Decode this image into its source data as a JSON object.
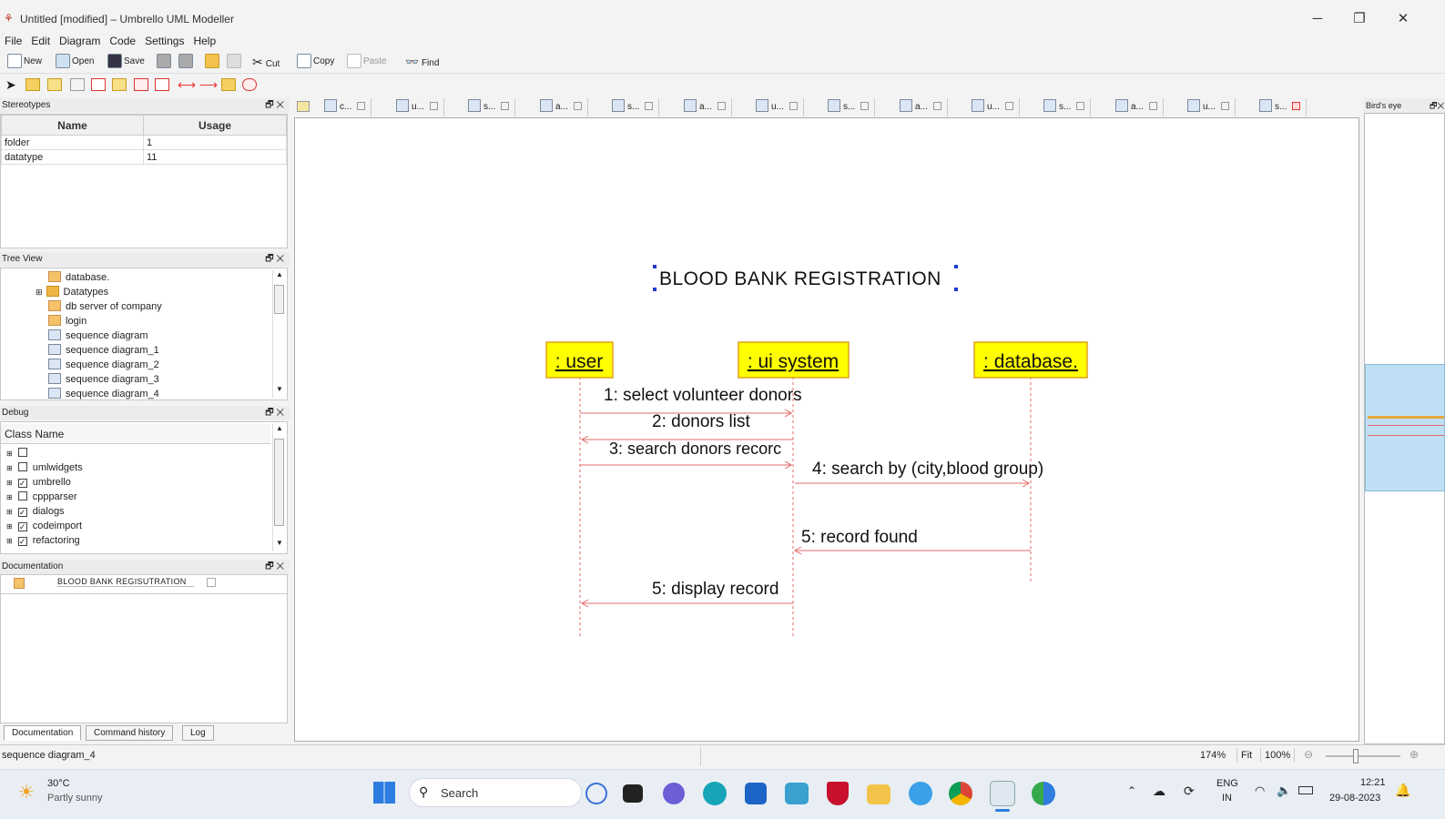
{
  "window": {
    "title": "Untitled [modified] – Umbrello UML Modeller",
    "minimize": "─",
    "maximize": "❐",
    "close": "✕"
  },
  "menu": [
    "File",
    "Edit",
    "Diagram",
    "Code",
    "Settings",
    "Help"
  ],
  "toolbar": {
    "new": "New",
    "open": "Open",
    "save": "Save",
    "cut": "Cut",
    "copy": "Copy",
    "paste": "Paste",
    "find": "Find"
  },
  "stereotypes": {
    "title": "Stereotypes",
    "columns": [
      "Name",
      "Usage"
    ],
    "rows": [
      {
        "name": "folder",
        "usage": "1"
      },
      {
        "name": "datatype",
        "usage": "11"
      }
    ]
  },
  "tree_view": {
    "title": "Tree View",
    "items": [
      "database.",
      "Datatypes",
      "db server of company",
      "login",
      "sequence diagram",
      "sequence diagram_1",
      "sequence diagram_2",
      "sequence diagram_3",
      "sequence diagram_4"
    ]
  },
  "debug": {
    "title": "Debug",
    "column": "Class Name",
    "items": [
      {
        "label": "",
        "checked": false
      },
      {
        "label": "umlwidgets",
        "checked": false
      },
      {
        "label": "umbrello",
        "checked": true
      },
      {
        "label": "cppparser",
        "checked": false
      },
      {
        "label": "dialogs",
        "checked": true
      },
      {
        "label": "codeimport",
        "checked": true
      },
      {
        "label": "refactoring",
        "checked": true
      }
    ]
  },
  "documentation": {
    "title": "Documentation",
    "entry": "BLOOD BANK REGISUTRATION"
  },
  "bottom_tabs": [
    "Documentation",
    "Command history",
    "Log"
  ],
  "diagram_tabs": [
    "c...",
    "u...",
    "s...",
    "a...",
    "s...",
    "a...",
    "u...",
    "s...",
    "a...",
    "u...",
    "s...",
    "a...",
    "u...",
    "s..."
  ],
  "diagram": {
    "title": "BLOOD BANK REGISTRATION",
    "lifelines": [
      ": user",
      ": ui system",
      ": database."
    ],
    "messages": [
      "1: select volunteer donors",
      "2: donors list",
      "3: search donors recorc",
      "4: search by (city,blood group)",
      "5: record found",
      "5: display record"
    ]
  },
  "birds_eye": {
    "title": "Bird's eye"
  },
  "status": {
    "left": "sequence diagram_4",
    "zoom": "174%",
    "fit": "Fit",
    "hundred": "100%"
  },
  "taskbar": {
    "weather_temp": "30°C",
    "weather_desc": "Partly sunny",
    "search": "Search",
    "lang_top": "ENG",
    "lang_bottom": "IN",
    "time": "12:21",
    "date": "29-08-2023"
  }
}
